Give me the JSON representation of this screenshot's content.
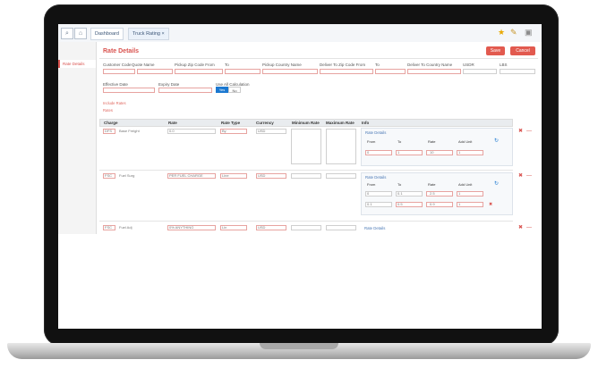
{
  "topbar": {
    "tabs": [
      "Dashboard",
      "Truck Rating ×"
    ],
    "home_icon": "home-icon",
    "search_icon": "search-icon"
  },
  "page": {
    "title": "Rate Details",
    "save_label": "Save",
    "cancel_label": "Cancel",
    "sidebar_item": "Rate Details"
  },
  "filters": {
    "labels": [
      "Customer Code",
      "Quote Name",
      "Pickup Zip Code From",
      "To",
      "Pickup Country Name",
      "Deliver To Zip Code From",
      "To",
      "Deliver To Country Name",
      "USDR",
      "LBS"
    ],
    "effective_date_label": "Effective Date",
    "expiry_date_label": "Expiry Date",
    "consider_label": "Use All Calculation",
    "toggle_yes": "Yes",
    "toggle_no": "No"
  },
  "section": {
    "link1": "Include Rates",
    "link2": "Rates"
  },
  "table": {
    "headers": [
      "Charge",
      "Rate",
      "Rate Type",
      "Currency",
      "Minimum Rate",
      "Maximum Rate",
      "Info"
    ],
    "rows": [
      {
        "code": "DFS",
        "name": "Base Freight",
        "rate": "0.0",
        "rate_type": "By",
        "currency": "USD",
        "has_panel": true
      },
      {
        "code": "FSC",
        "name": "Fuel Surg",
        "rate": "PER FUEL CHARGE",
        "rate_type": "Line",
        "currency": "USD",
        "has_panel": true
      },
      {
        "code": "FSC",
        "name": "Fuel Adj",
        "rate": "0% ANYTHING",
        "rate_type": "Lin",
        "currency": "USD",
        "has_panel": false
      }
    ],
    "panel_link": "Rate Details",
    "panel_headers": [
      "From",
      "To",
      "Rate",
      "Add Unit"
    ],
    "panel1_values": [
      "0",
      "1",
      "10",
      "1"
    ],
    "panel2_row1": [
      "0",
      "0.1",
      "2.5",
      "1"
    ],
    "panel2_row2": [
      "0.1",
      "0.5",
      "0.9",
      "1"
    ],
    "add_rate_link": "Rate Details"
  }
}
